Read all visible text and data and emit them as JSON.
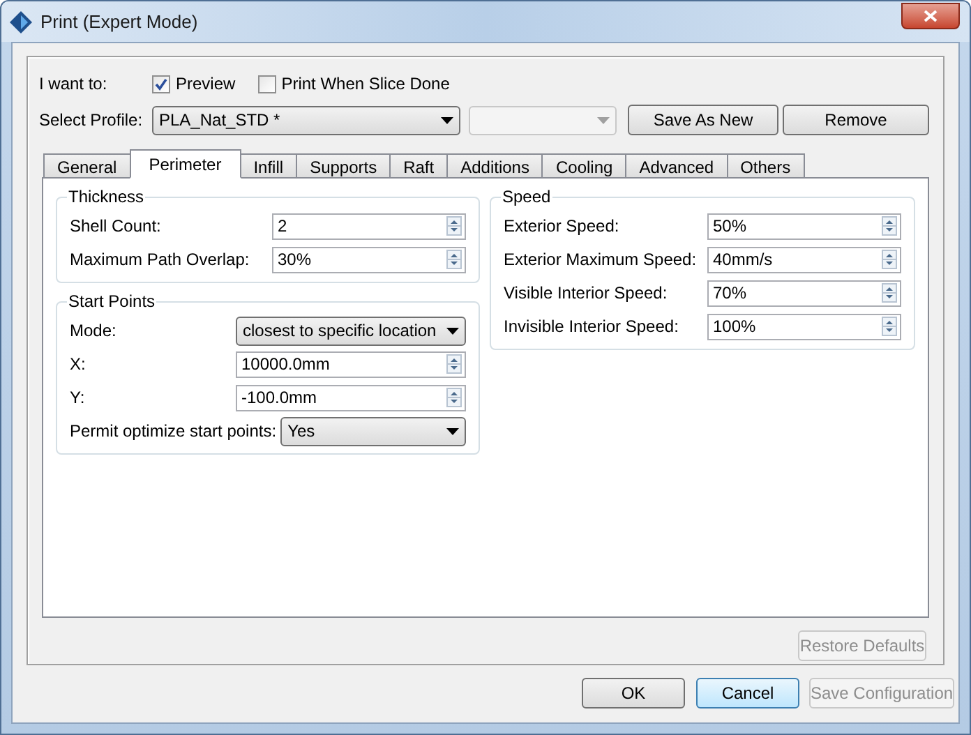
{
  "window": {
    "title": "Print (Expert Mode)"
  },
  "options": {
    "label": "I want to:",
    "checkboxes": [
      {
        "label": "Preview",
        "checked": true
      },
      {
        "label": "Print When Slice Done",
        "checked": false
      }
    ]
  },
  "profile": {
    "label": "Select Profile:",
    "value": "PLA_Nat_STD *",
    "secondary_select": {
      "disabled": true
    },
    "buttons": [
      {
        "label": "Save As New"
      },
      {
        "label": "Remove"
      }
    ]
  },
  "tabs": [
    {
      "label": "General",
      "selected": false
    },
    {
      "label": "Perimeter",
      "selected": true
    },
    {
      "label": "Infill",
      "selected": false
    },
    {
      "label": "Supports",
      "selected": false
    },
    {
      "label": "Raft",
      "selected": false
    },
    {
      "label": "Additions",
      "selected": false
    },
    {
      "label": "Cooling",
      "selected": false
    },
    {
      "label": "Advanced",
      "selected": false
    },
    {
      "label": "Others",
      "selected": false
    }
  ],
  "left_groups": [
    {
      "title": "Thickness",
      "rows": [
        {
          "kind": "spin",
          "label": "Shell Count:",
          "value": "2"
        },
        {
          "kind": "spin",
          "label": "Maximum Path Overlap:",
          "value": "30%"
        }
      ]
    },
    {
      "title": "Start Points",
      "rows": [
        {
          "kind": "select",
          "label": "Mode:",
          "value": "closest to specific location"
        },
        {
          "kind": "spin",
          "label": "X:",
          "value": "10000.0mm"
        },
        {
          "kind": "spin",
          "label": "Y:",
          "value": "-100.0mm"
        },
        {
          "kind": "select",
          "label": "Permit optimize start points:",
          "value": "Yes"
        }
      ]
    }
  ],
  "right_groups": [
    {
      "title": "Speed",
      "rows": [
        {
          "kind": "spin",
          "label": "Exterior Speed:",
          "value": "50%"
        },
        {
          "kind": "spin",
          "label": "Exterior Maximum Speed:",
          "value": "40mm/s"
        },
        {
          "kind": "spin",
          "label": "Visible Interior Speed:",
          "value": "70%"
        },
        {
          "kind": "spin",
          "label": "Invisible Interior Speed:",
          "value": "100%"
        }
      ]
    }
  ],
  "restore_button": {
    "label": "Restore Defaults",
    "disabled": true
  },
  "footer_buttons": [
    {
      "label": "OK",
      "focused": false,
      "disabled": false
    },
    {
      "label": "Cancel",
      "focused": true,
      "disabled": false
    },
    {
      "label": "Save Configuration",
      "focused": false,
      "disabled": true
    }
  ]
}
